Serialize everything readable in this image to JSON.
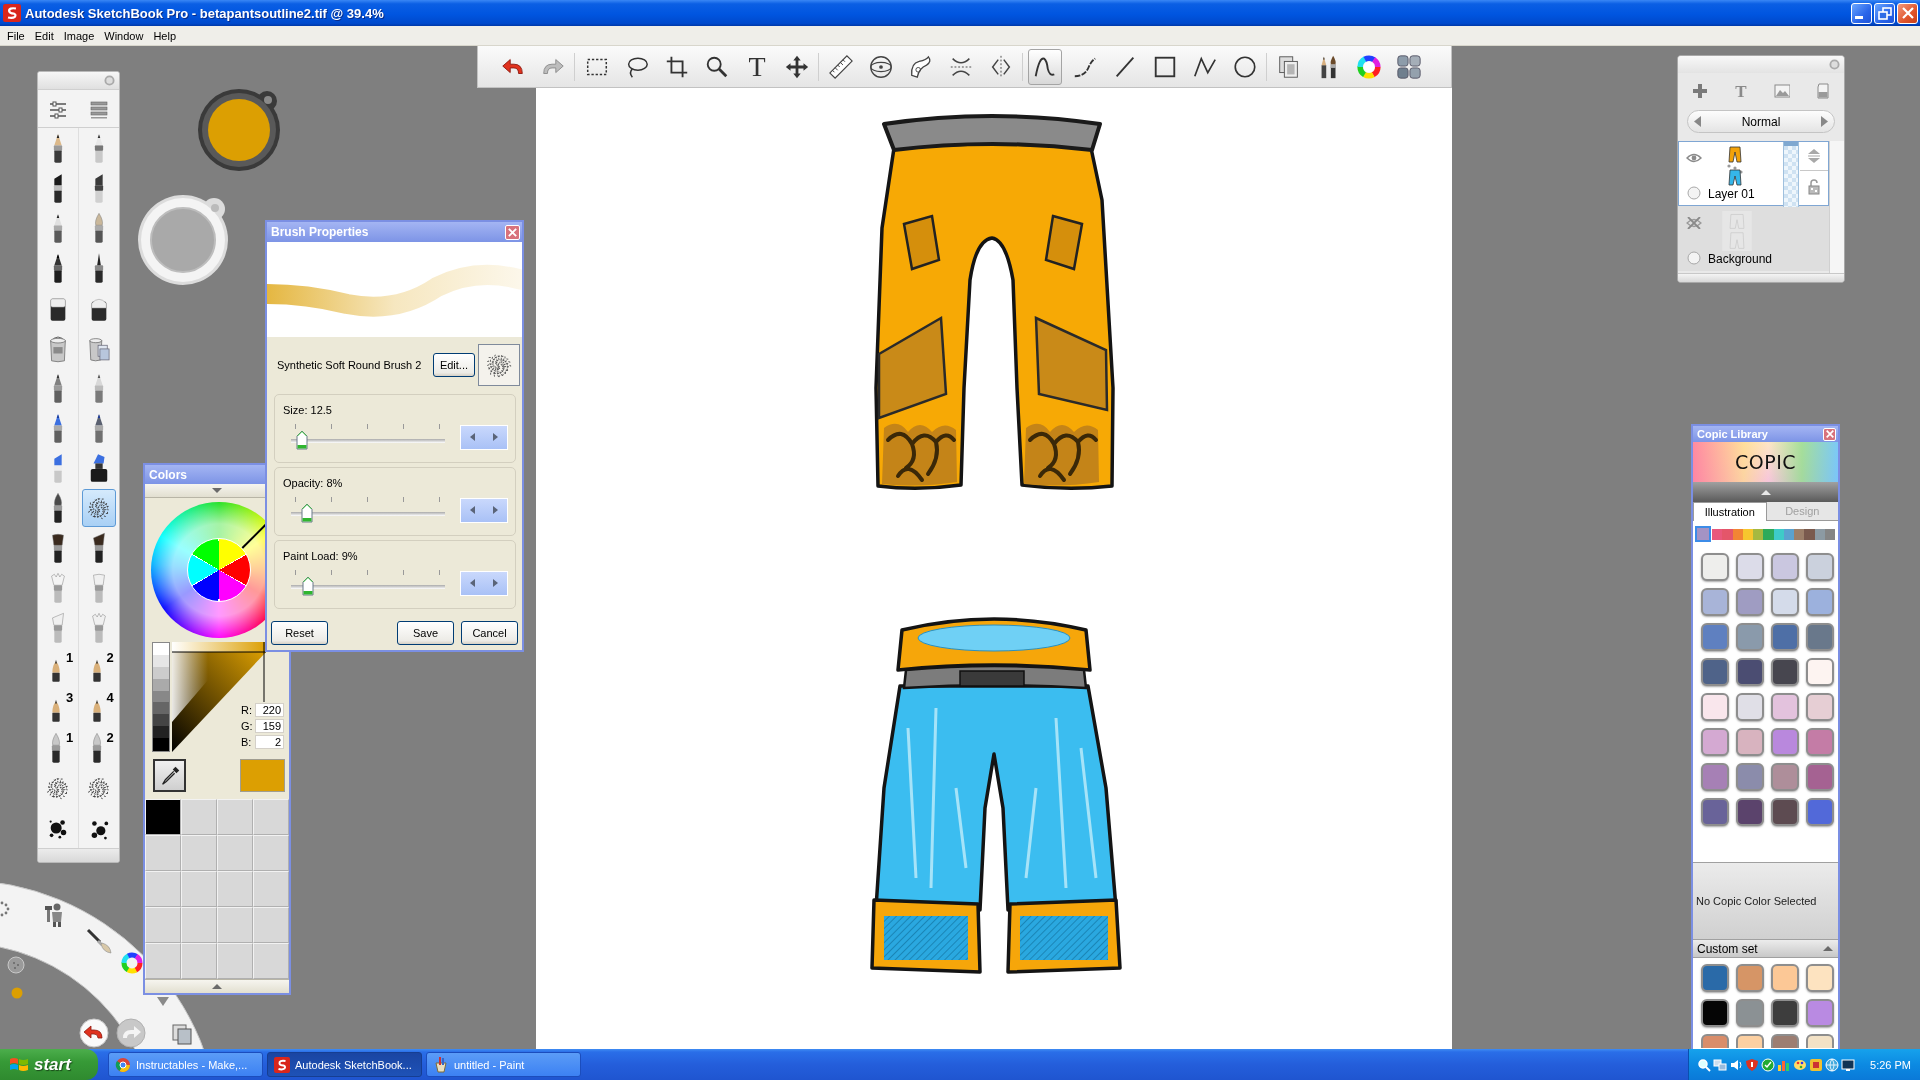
{
  "window": {
    "title": "Autodesk SketchBook Pro - betapantsoutline2.tif @ 39.4%",
    "controls": [
      {
        "kind": "minimize"
      },
      {
        "kind": "restore"
      },
      {
        "kind": "close"
      }
    ]
  },
  "menu": [
    "File",
    "Edit",
    "Image",
    "Window",
    "Help"
  ],
  "toolbar": {
    "groups": [
      {
        "tools": [
          {
            "kind": "undo",
            "selected": false
          },
          {
            "kind": "redo",
            "selected": false
          }
        ]
      },
      {
        "tools": [
          {
            "kind": "select",
            "selected": false
          },
          {
            "kind": "lasso",
            "selected": false
          },
          {
            "kind": "crop",
            "selected": false
          },
          {
            "kind": "zoom",
            "selected": false
          },
          {
            "kind": "text",
            "label": "T",
            "selected": false
          },
          {
            "kind": "move",
            "selected": false
          }
        ]
      },
      {
        "tools": [
          {
            "kind": "ruler",
            "selected": false
          },
          {
            "kind": "ellipse",
            "selected": false
          },
          {
            "kind": "frenchcurve",
            "selected": false
          },
          {
            "kind": "symmetryx",
            "selected": false
          },
          {
            "kind": "symmetryy",
            "selected": false
          }
        ]
      },
      {
        "tools": [
          {
            "kind": "freehand",
            "selected": true
          },
          {
            "kind": "curve",
            "selected": false
          },
          {
            "kind": "line",
            "selected": false
          },
          {
            "kind": "rectangle",
            "selected": false
          },
          {
            "kind": "polyline",
            "selected": false
          },
          {
            "kind": "circle",
            "selected": false
          }
        ]
      },
      {
        "tools": [
          {
            "kind": "layers",
            "selected": false
          },
          {
            "kind": "brushes",
            "selected": false
          },
          {
            "kind": "colorwheel",
            "selected": false
          },
          {
            "kind": "copic",
            "selected": false
          }
        ]
      }
    ]
  },
  "brush_palette": {
    "views": [
      {
        "kind": "sliders"
      },
      {
        "kind": "list"
      }
    ],
    "brushes": [
      {
        "kind": "pencil",
        "selected": false
      },
      {
        "kind": "technical",
        "selected": false
      },
      {
        "kind": "marker",
        "selected": false
      },
      {
        "kind": "chisel",
        "selected": false
      },
      {
        "kind": "ballpoint",
        "selected": false
      },
      {
        "kind": "pointed",
        "selected": false
      },
      {
        "kind": "fineliner",
        "selected": false
      },
      {
        "kind": "inkpen",
        "selected": false
      },
      {
        "kind": "eraser",
        "selected": false
      },
      {
        "kind": "softeraser",
        "selected": false
      },
      {
        "kind": "bucket",
        "selected": false
      },
      {
        "kind": "layerbucket",
        "selected": false
      },
      {
        "kind": "airbrush",
        "selected": false
      },
      {
        "kind": "felt",
        "selected": false
      },
      {
        "kind": "bluemarker",
        "selected": false
      },
      {
        "kind": "graymarker",
        "selected": false
      },
      {
        "kind": "highlighter",
        "selected": false
      },
      {
        "kind": "inkbottle",
        "selected": false
      },
      {
        "kind": "round",
        "selected": false
      },
      {
        "kind": "scatter",
        "selected": true
      },
      {
        "kind": "flat",
        "selected": false
      },
      {
        "kind": "angled",
        "selected": false
      },
      {
        "kind": "fan",
        "selected": false
      },
      {
        "kind": "bristle",
        "selected": false
      },
      {
        "kind": "wide",
        "selected": false
      },
      {
        "kind": "blender",
        "selected": false
      },
      {
        "kind": "nib",
        "number": "1",
        "selected": false
      },
      {
        "kind": "nib",
        "number": "2",
        "selected": false
      },
      {
        "kind": "nib",
        "number": "3",
        "selected": false
      },
      {
        "kind": "nib",
        "number": "4",
        "selected": false
      },
      {
        "kind": "quill",
        "number": "1",
        "selected": false
      },
      {
        "kind": "quill",
        "number": "2",
        "selected": false
      },
      {
        "kind": "speckle",
        "selected": false
      },
      {
        "kind": "spray",
        "selected": false
      },
      {
        "kind": "splatter",
        "selected": false
      },
      {
        "kind": "drops",
        "selected": false
      }
    ]
  },
  "colors": {
    "title": "Colors",
    "rgb": [
      {
        "label": "R:",
        "value": "220"
      },
      {
        "label": "G:",
        "value": "159"
      },
      {
        "label": "B:",
        "value": "2"
      }
    ],
    "swatches": [
      {
        "kind": "color",
        "color": "#000000"
      },
      {
        "kind": "empty"
      },
      {
        "kind": "empty"
      },
      {
        "kind": "empty"
      },
      {
        "kind": "empty"
      },
      {
        "kind": "empty"
      },
      {
        "kind": "empty"
      },
      {
        "kind": "empty"
      },
      {
        "kind": "empty"
      },
      {
        "kind": "empty"
      },
      {
        "kind": "empty"
      },
      {
        "kind": "empty"
      },
      {
        "kind": "empty"
      },
      {
        "kind": "empty"
      },
      {
        "kind": "empty"
      },
      {
        "kind": "empty"
      },
      {
        "kind": "empty"
      },
      {
        "kind": "empty"
      },
      {
        "kind": "empty"
      },
      {
        "kind": "empty"
      }
    ]
  },
  "brush_properties": {
    "title": "Brush Properties",
    "brush_name": "Synthetic Soft Round Brush 2",
    "edit_button": "Edit...",
    "sliders": [
      {
        "label": "Size: 12.5",
        "level": 0.05
      },
      {
        "label": "Opacity: 8%",
        "level": 0.08
      },
      {
        "label": "Paint Load: 9%",
        "level": 0.09
      }
    ],
    "buttons": [
      "Reset",
      "Save",
      "Cancel"
    ]
  },
  "layers": {
    "tools": [
      {
        "kind": "add"
      },
      {
        "kind": "text",
        "label": "T"
      },
      {
        "kind": "image"
      },
      {
        "kind": "clear"
      }
    ],
    "blend_mode": "Normal",
    "items": [
      {
        "name": "Layer 01",
        "selected": true,
        "visible": true,
        "level": 1
      },
      {
        "name": "Background",
        "selected": false,
        "visible": false
      }
    ]
  },
  "copic": {
    "title": "Copic Library",
    "logo": "COPIC",
    "tabs": [
      {
        "label": "Illustration",
        "selected": true
      },
      {
        "label": "Design",
        "selected": false
      }
    ],
    "families": [
      {
        "color": "#a493c4",
        "selected": true
      },
      {
        "color": "#e9587c",
        "selected": false
      },
      {
        "color": "#e4566a",
        "selected": false
      },
      {
        "color": "#f28534",
        "selected": false
      },
      {
        "color": "#f7c62e",
        "selected": false
      },
      {
        "color": "#a6b940",
        "selected": false
      },
      {
        "color": "#2eaa5a",
        "selected": false
      },
      {
        "color": "#3ecbc8",
        "selected": false
      },
      {
        "color": "#5aa2cf",
        "selected": false
      },
      {
        "color": "#9c7f69",
        "selected": false
      },
      {
        "color": "#7a5a4e",
        "selected": false
      },
      {
        "color": "#8c9aa3",
        "selected": false
      },
      {
        "color": "#858585",
        "selected": false
      }
    ],
    "swatches": [
      {
        "color": "#eeeeec"
      },
      {
        "color": "#dcdce9"
      },
      {
        "color": "#cac7e0"
      },
      {
        "color": "#cbd1dd"
      },
      {
        "color": "#a8b4d8"
      },
      {
        "color": "#9f9cc2"
      },
      {
        "color": "#d4dbea"
      },
      {
        "color": "#9cb1dd"
      },
      {
        "color": "#5f80c0"
      },
      {
        "color": "#8a9aab"
      },
      {
        "color": "#4e6fa6"
      },
      {
        "color": "#69788b"
      },
      {
        "color": "#4f6389"
      },
      {
        "color": "#4b4d72"
      },
      {
        "color": "#47464f"
      },
      {
        "color": "#fdf4f1"
      },
      {
        "color": "#f9e6ec"
      },
      {
        "color": "#e0dfe7"
      },
      {
        "color": "#e3c2dd"
      },
      {
        "color": "#e6ced4"
      },
      {
        "color": "#d4a9d2"
      },
      {
        "color": "#d8b3bf"
      },
      {
        "color": "#b988dd"
      },
      {
        "color": "#c47ca6"
      },
      {
        "color": "#a680b5"
      },
      {
        "color": "#8b8cab"
      },
      {
        "color": "#ae8e9a"
      },
      {
        "color": "#a56292"
      },
      {
        "color": "#696399"
      },
      {
        "color": "#5b436c"
      },
      {
        "color": "#5d4b51"
      },
      {
        "color": "#5269d9"
      }
    ],
    "status": "No Copic Color Selected",
    "custom_set": {
      "title": "Custom set",
      "swatches": [
        {
          "color": "#2a6aa8"
        },
        {
          "color": "#d69566"
        },
        {
          "color": "#fcc896"
        },
        {
          "color": "#fde3c0"
        },
        {
          "color": "#050505"
        },
        {
          "color": "#8b9194"
        },
        {
          "color": "#3d3d3d"
        },
        {
          "color": "#b98ae2"
        },
        {
          "color": "#d98d6a"
        },
        {
          "color": "#fcd0a2"
        },
        {
          "color": "#9c7e72"
        },
        {
          "color": "#f3e2c6"
        }
      ]
    }
  },
  "taskbar": {
    "start": "start",
    "tasks": [
      {
        "kind": "browser",
        "label": "Instructables - Make,...",
        "selected": false
      },
      {
        "kind": "sketchbook",
        "label": "Autodesk SketchBook...",
        "selected": true
      },
      {
        "kind": "paint",
        "label": "untitled - Paint",
        "selected": false
      }
    ],
    "tray": [
      {
        "kind": "search"
      },
      {
        "kind": "network"
      },
      {
        "kind": "volume"
      },
      {
        "kind": "alert"
      },
      {
        "kind": "shield"
      },
      {
        "kind": "chart"
      },
      {
        "kind": "palette"
      },
      {
        "kind": "app"
      },
      {
        "kind": "globe"
      },
      {
        "kind": "display"
      }
    ],
    "clock": "5:26 PM"
  }
}
